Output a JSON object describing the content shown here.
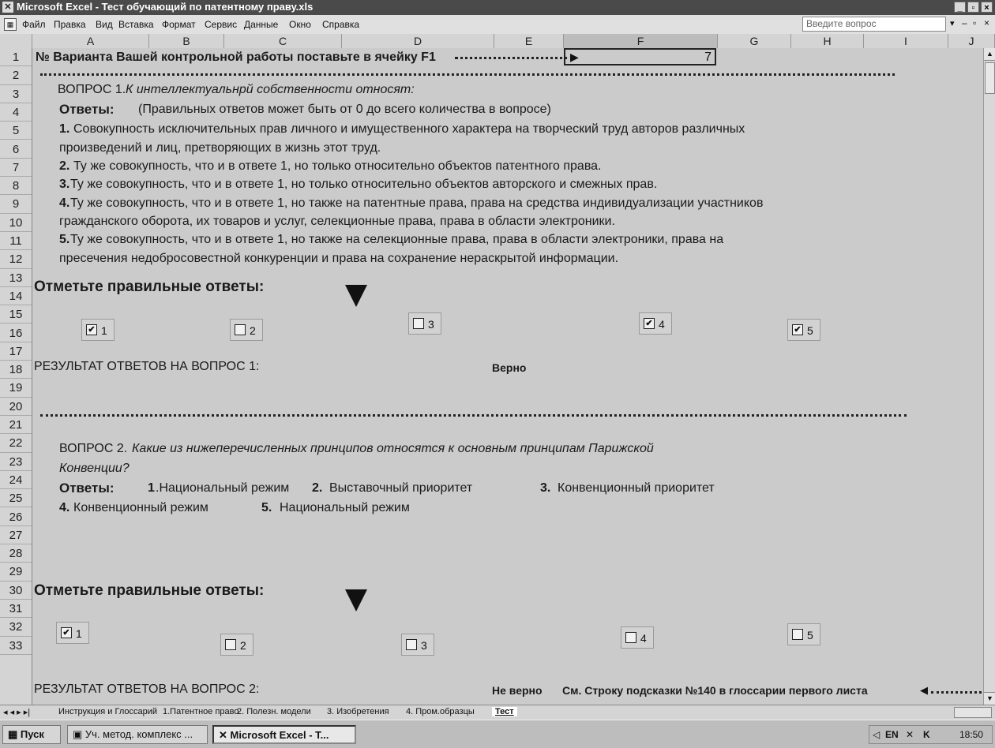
{
  "window": {
    "title": "Microsoft Excel - Тест обучающий по патентному праву.xls",
    "controls": [
      "_",
      "▫",
      "×"
    ]
  },
  "menu": {
    "items": [
      "Файл",
      "Правка",
      "Вид",
      "Вставка",
      "Формат",
      "Сервис",
      "Данные",
      "Окно",
      "Справка"
    ],
    "ask_placeholder": "Введите вопрос"
  },
  "columns": [
    "A",
    "B",
    "C",
    "D",
    "E",
    "F",
    "G",
    "H",
    "I",
    "J"
  ],
  "rows": [
    "1",
    "2",
    "3",
    "4",
    "5",
    "6",
    "7",
    "8",
    "9",
    "10",
    "11",
    "12",
    "13",
    "14",
    "15",
    "16",
    "17",
    "18",
    "19",
    "20",
    "21",
    "22",
    "23",
    "24",
    "25",
    "26",
    "27",
    "28",
    "29",
    "30",
    "31",
    "32",
    "33"
  ],
  "sheet": {
    "row1": "№ Варианта Вашей контрольной работы поставьте в ячейку F1",
    "variant_value": "7",
    "q1": {
      "label": "ВОПРОС 1.",
      "text": "К интеллектуальнрй собственности относят:",
      "answers_label": "Ответы:",
      "answers_note": "(Правильных ответов может быть от 0 до всего количества в вопросе)",
      "a1_num": "1.",
      "a1_line1": "Совокупность исключительных прав личного и имущественного характера на творческий труд авторов различных",
      "a1_line2": "произведений и лиц, претворяющих в жизнь этот труд.",
      "a2_num": "2.",
      "a2": "Ту же совокупность, что и в ответе 1, но только относительно объектов патентного права.",
      "a3_num": "3.",
      "a3": "Ту же совокупность, что и в ответе 1, но только относительно объектов авторского и смежных прав.",
      "a4_num": "4.",
      "a4_line1": "Ту же совокупность, что и в ответе 1, но  также на патентные права, права на средства индивидуализации участников",
      "a4_line2": "гражданского оборота, их товаров и услуг, селекционные права, права в области электроники.",
      "a5_num": "5.",
      "a5_line1": "Ту же совокупность, что и в ответе 1, но  также на селекционные права, права в области электроники, права на",
      "a5_line2": "пресечения недобросовестной конкуренции и права на сохранение нераскрытой информации.",
      "mark_label": "Отметьте правильные ответы:",
      "checkboxes": [
        {
          "label": "1",
          "checked": true
        },
        {
          "label": "2",
          "checked": false
        },
        {
          "label": "3",
          "checked": false
        },
        {
          "label": "4",
          "checked": true
        },
        {
          "label": "5",
          "checked": true
        }
      ],
      "result_label": "РЕЗУЛЬТАТ ОТВЕТОВ   НА ВОПРОС 1:",
      "result_value": "Верно"
    },
    "q2": {
      "label": "ВОПРОС 2.",
      "text_line1": "Какие из нижеперечисленных принципов  относятся к основным принципам Парижской",
      "text_line2": "Конвенции?",
      "answers_label": "Ответы:",
      "a1_num": "1",
      "a1": ".Национальный режим",
      "a2_num": "2.",
      "a2": "Выставочный приоритет",
      "a3_num": "3.",
      "a3": "Конвенционный приоритет",
      "a4_num": "4.",
      "a4": "Конвенционный режим",
      "a5_num": "5.",
      "a5": "Национальный режим",
      "mark_label": "Отметьте правильные ответы:",
      "checkboxes": [
        {
          "label": "1",
          "checked": true
        },
        {
          "label": "2",
          "checked": false
        },
        {
          "label": "3",
          "checked": false
        },
        {
          "label": "4",
          "checked": false
        },
        {
          "label": "5",
          "checked": false
        }
      ],
      "result_label": "РЕЗУЛЬТАТ ОТВЕТОВ   НА ВОПРОС 2:",
      "result_value": "Не верно",
      "hint": "См. Строку подсказки №140 в  глоссарии первого листа"
    }
  },
  "sheet_tabs": [
    "Инструкция и Глоссарий",
    "1.Патентное право",
    "2. Полезн. модели",
    "3. Изобретения",
    "4. Пром.образцы",
    "Тест"
  ],
  "active_tab": "Тест",
  "taskbar": {
    "start": "Пуск",
    "tasks": [
      "Уч. метод. комплекс ...",
      "Microsoft Excel - T..."
    ],
    "lang": "EN",
    "clock": "18:50"
  }
}
